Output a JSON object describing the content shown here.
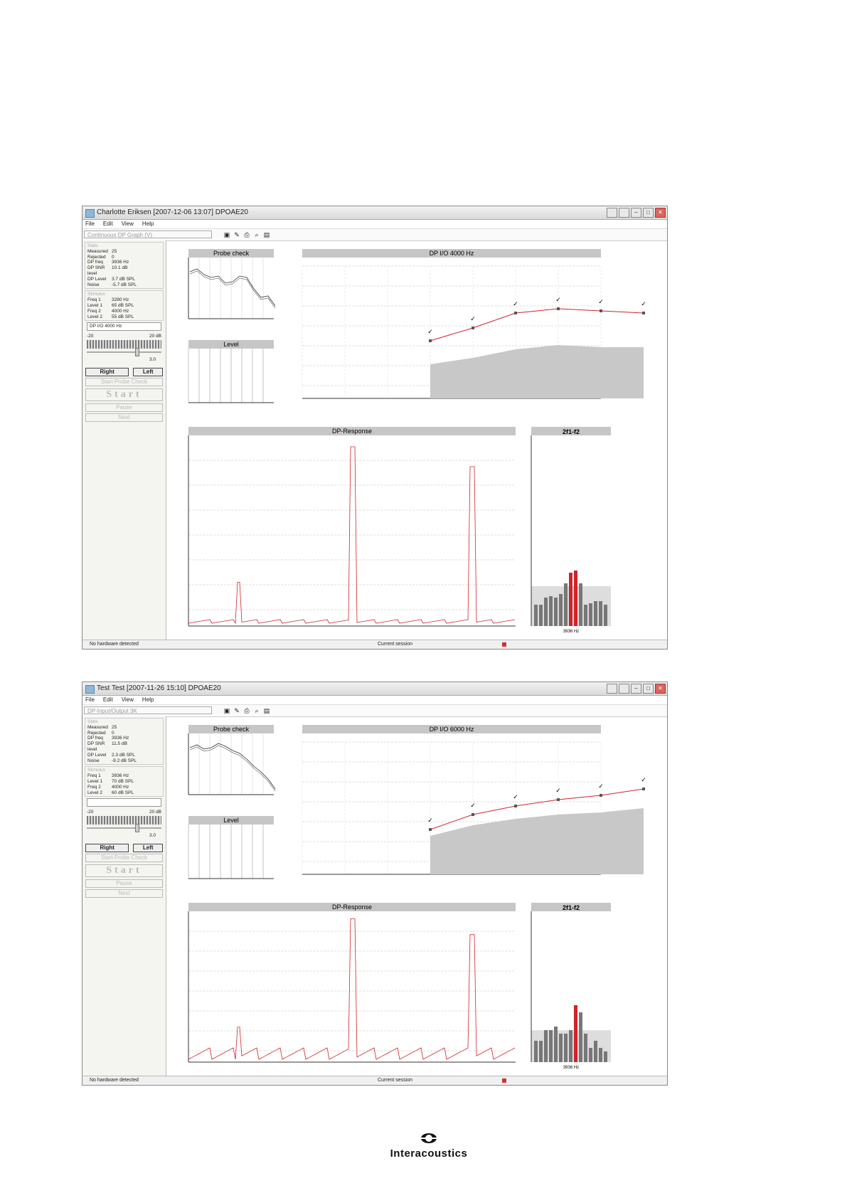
{
  "windows": [
    {
      "title": "Charlotte Eriksen  [2007-12-06 13:07]  DPOAE20",
      "menu": [
        "File",
        "Edit",
        "View",
        "Help"
      ],
      "protocol": "Continuous DP Graph (V)",
      "stats": [
        [
          "Measured",
          "25"
        ],
        [
          "Rejected",
          "0"
        ],
        [
          "DP freq",
          "3936 Hz"
        ],
        [
          "DP SNR level",
          "10.1 dB"
        ],
        [
          "DP Level",
          "3.7 dB SPL"
        ],
        [
          "Noise",
          "-5.7 dB SPL"
        ]
      ],
      "stimulus": [
        [
          "Freq 1",
          "3280 Hz"
        ],
        [
          "Level 1",
          "65 dB SPL"
        ],
        [
          "Freq 2",
          "4000 Hz"
        ],
        [
          "Level 2",
          "55 dB SPL"
        ]
      ],
      "freq_select": "DP I/O 4000 Hz",
      "reject_range": [
        "-20",
        "20 dB"
      ],
      "slider_value": "3.0",
      "buttons": {
        "right": "Right",
        "left": "Left",
        "probe": "Start Probe Check",
        "start": "Start",
        "pause": "Pause",
        "next": "Next"
      },
      "status_left": "No hardware detected",
      "status_mid": "Current session",
      "probe_title": "Probe check",
      "level_title": "Level",
      "io_title": "DP I/O 4000 Hz",
      "resp_title": "DP-Response",
      "bar_title": "2f1-f2",
      "io_points": [
        [
          55,
          -3
        ],
        [
          60,
          3
        ],
        [
          65,
          10
        ],
        [
          70,
          12
        ],
        [
          75,
          11
        ],
        [
          80,
          10
        ]
      ],
      "io_noise": [
        [
          55,
          -14
        ],
        [
          60,
          -11
        ],
        [
          65,
          -7
        ],
        [
          70,
          -5
        ],
        [
          75,
          -6
        ],
        [
          80,
          -6
        ]
      ],
      "bar_label": "3936 Hz"
    },
    {
      "title": "Test Test  [2007-11-26 15:10]  DPOAE20",
      "menu": [
        "File",
        "Edit",
        "View",
        "Help"
      ],
      "protocol": "DP-Input/Output 3K",
      "stats": [
        [
          "Measured",
          "25"
        ],
        [
          "Rejected",
          "0"
        ],
        [
          "DP freq",
          "3936 Hz"
        ],
        [
          "DP SNR level",
          "11.5 dB"
        ],
        [
          "DP Level",
          "2.3 dB SPL"
        ],
        [
          "Noise",
          "-9.2 dB SPL"
        ]
      ],
      "stimulus": [
        [
          "Freq 1",
          "3936 Hz"
        ],
        [
          "Level 1",
          "70 dB SPL"
        ],
        [
          "Freq 2",
          "4000 Hz"
        ],
        [
          "Level 2",
          "60 dB SPL"
        ]
      ],
      "freq_select": "",
      "reject_range": [
        "-20",
        "20 dB"
      ],
      "slider_value": "3.0",
      "buttons": {
        "right": "Right",
        "left": "Left",
        "probe": "Start Probe Check",
        "start": "Start",
        "pause": "Pause",
        "next": "Next"
      },
      "status_left": "No hardware detected",
      "status_mid": "Current session",
      "probe_title": "Probe check",
      "level_title": "Level",
      "io_title": "DP I/O 6000 Hz",
      "resp_title": "DP-Response",
      "bar_title": "2f1-f2",
      "io_points": [
        [
          55,
          -9
        ],
        [
          60,
          -2
        ],
        [
          65,
          2
        ],
        [
          70,
          5
        ],
        [
          75,
          7
        ],
        [
          80,
          10
        ]
      ],
      "io_noise": [
        [
          55,
          -12
        ],
        [
          60,
          -7
        ],
        [
          65,
          -4
        ],
        [
          70,
          -2
        ],
        [
          75,
          -1
        ],
        [
          80,
          1
        ]
      ],
      "bar_label": "3936 Hz"
    }
  ],
  "brand": "Interacoustics",
  "colors": {
    "red": "#d0232a",
    "grey": "#c8c8c8",
    "header": "#c6c6c6"
  }
}
